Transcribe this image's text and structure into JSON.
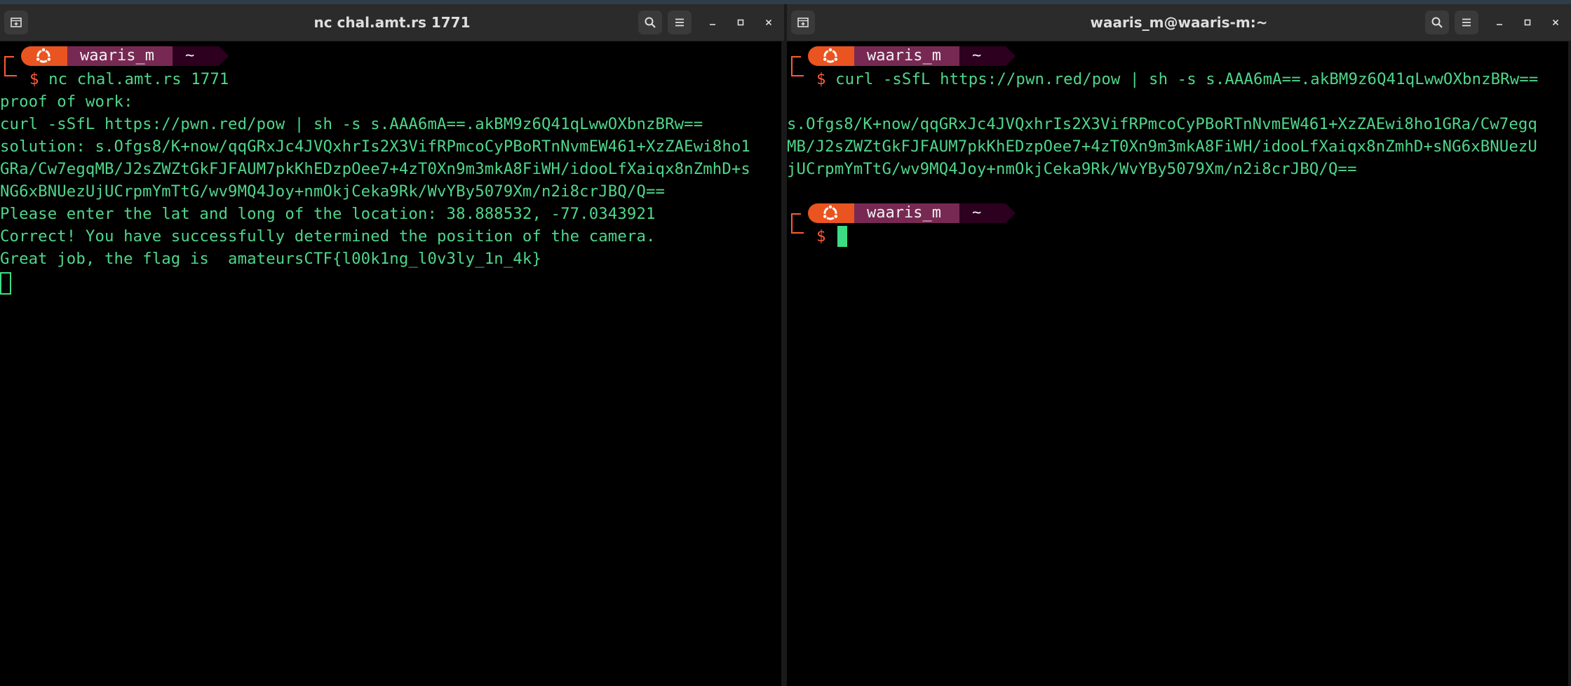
{
  "left": {
    "title": "nc chal.amt.rs 1771",
    "prompt": {
      "user": "waaris_m",
      "dir": "~",
      "symbol": "$"
    },
    "command": "nc chal.amt.rs 1771",
    "output": [
      "proof of work:",
      "curl -sSfL https://pwn.red/pow | sh -s s.AAA6mA==.akBM9z6Q41qLwwOXbnzBRw==",
      "solution: s.Ofgs8/K+now/qqGRxJc4JVQxhrIs2X3VifRPmcoCyPBoRTnNvmEW461+XzZAEwi8ho1",
      "GRa/Cw7egqMB/J2sZWZtGkFJFAUM7pkKhEDzpOee7+4zT0Xn9m3mkA8FiWH/idooLfXaiqx8nZmhD+s",
      "NG6xBNUezUjUCrpmYmTtG/wv9MQ4Joy+nmOkjCeka9Rk/WvYBy5079Xm/n2i8crJBQ/Q==",
      "Please enter the lat and long of the location: 38.888532, -77.0343921",
      "Correct! You have successfully determined the position of the camera.",
      "Great job, the flag is  amateursCTF{l00k1ng_l0v3ly_1n_4k}"
    ]
  },
  "right": {
    "title": "waaris_m@waaris-m:~",
    "prompt": {
      "user": "waaris_m",
      "dir": "~",
      "symbol": "$"
    },
    "command": "curl -sSfL https://pwn.red/pow | sh -s s.AAA6mA==.akBM9z6Q41qLwwOXbnzBRw==",
    "output": [
      "s.Ofgs8/K+now/qqGRxJc4JVQxhrIs2X3VifRPmcoCyPBoRTnNvmEW461+XzZAEwi8ho1GRa/Cw7egq",
      "MB/J2sZWZtGkFJFAUM7pkKhEDzpOee7+4zT0Xn9m3mkA8FiWH/idooLfXaiqx8nZmhD+sNG6xBNUezU",
      "jUCrpmYmTtG/wv9MQ4Joy+nmOkjCeka9Rk/WvYBy5079Xm/n2i8crJBQ/Q=="
    ]
  },
  "colors": {
    "terminal_bg": "#000000",
    "text_green": "#4fd68a",
    "prompt_orange": "#ff5a36",
    "ubuntu_orange": "#e95420",
    "ubuntu_aubergine": "#772953",
    "ubuntu_dark_aubergine": "#2c001e",
    "cursor_green": "#3ddc84"
  },
  "icons": {
    "new_tab": "new-tab-icon",
    "search": "search-icon",
    "menu": "hamburger-menu-icon",
    "minimize": "minimize-icon",
    "maximize": "maximize-icon",
    "close": "close-icon",
    "prompt_logo": "ubuntu-logo-icon"
  }
}
